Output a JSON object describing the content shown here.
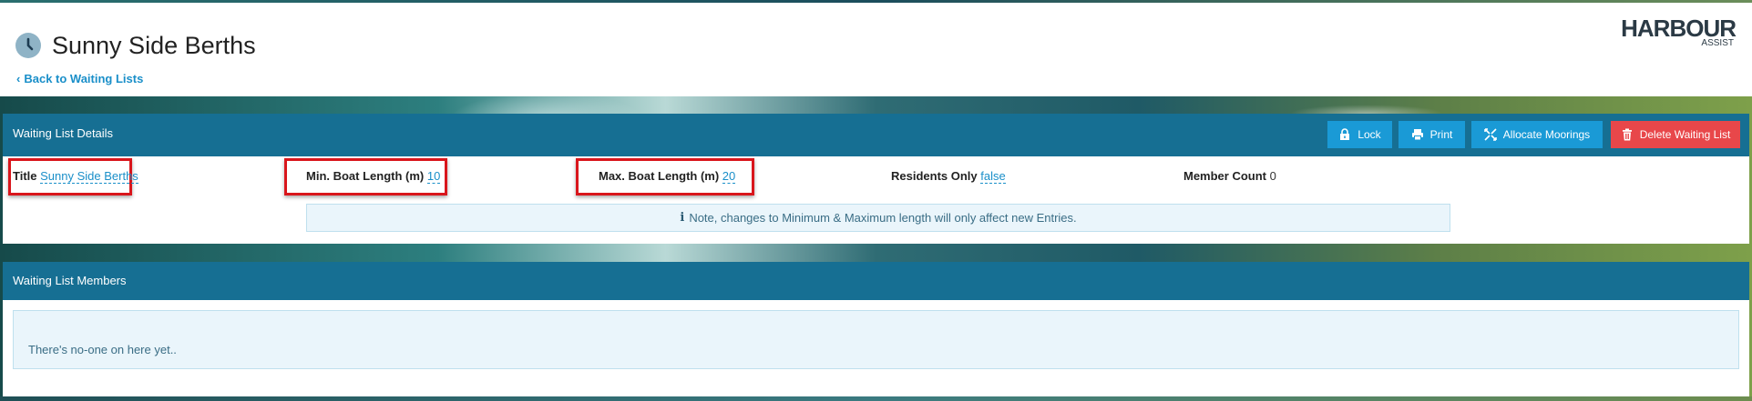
{
  "header": {
    "title": "Sunny Side Berths",
    "back_link": "Back to Waiting Lists",
    "logo": {
      "brand": "HARBOUR",
      "sub": "ASSIST"
    }
  },
  "details": {
    "section_title": "Waiting List Details",
    "buttons": {
      "lock": "Lock",
      "print": "Print",
      "allocate": "Allocate Moorings",
      "delete": "Delete Waiting List"
    },
    "fields": {
      "title": {
        "label": "Title",
        "value": "Sunny Side Berths"
      },
      "min_length": {
        "label": "Min. Boat Length (m)",
        "value": "10"
      },
      "max_length": {
        "label": "Max. Boat Length (m)",
        "value": "20"
      },
      "residents_only": {
        "label": "Residents Only",
        "value": "false"
      },
      "member_count": {
        "label": "Member Count",
        "value": "0"
      }
    },
    "note": "Note, changes to Minimum & Maximum length will only affect new Entries."
  },
  "members": {
    "section_title": "Waiting List Members",
    "empty_message": "There's no-one on here yet.."
  },
  "colors": {
    "section_bar": "#166f93",
    "button_blue": "#1a9ad6",
    "button_red": "#e8474a",
    "link": "#1a8fc9",
    "highlight": "#d9161c"
  },
  "icons": [
    "clock-icon",
    "chevron-left-icon",
    "lock-icon",
    "print-icon",
    "allocate-icon",
    "trash-icon",
    "info-icon"
  ]
}
